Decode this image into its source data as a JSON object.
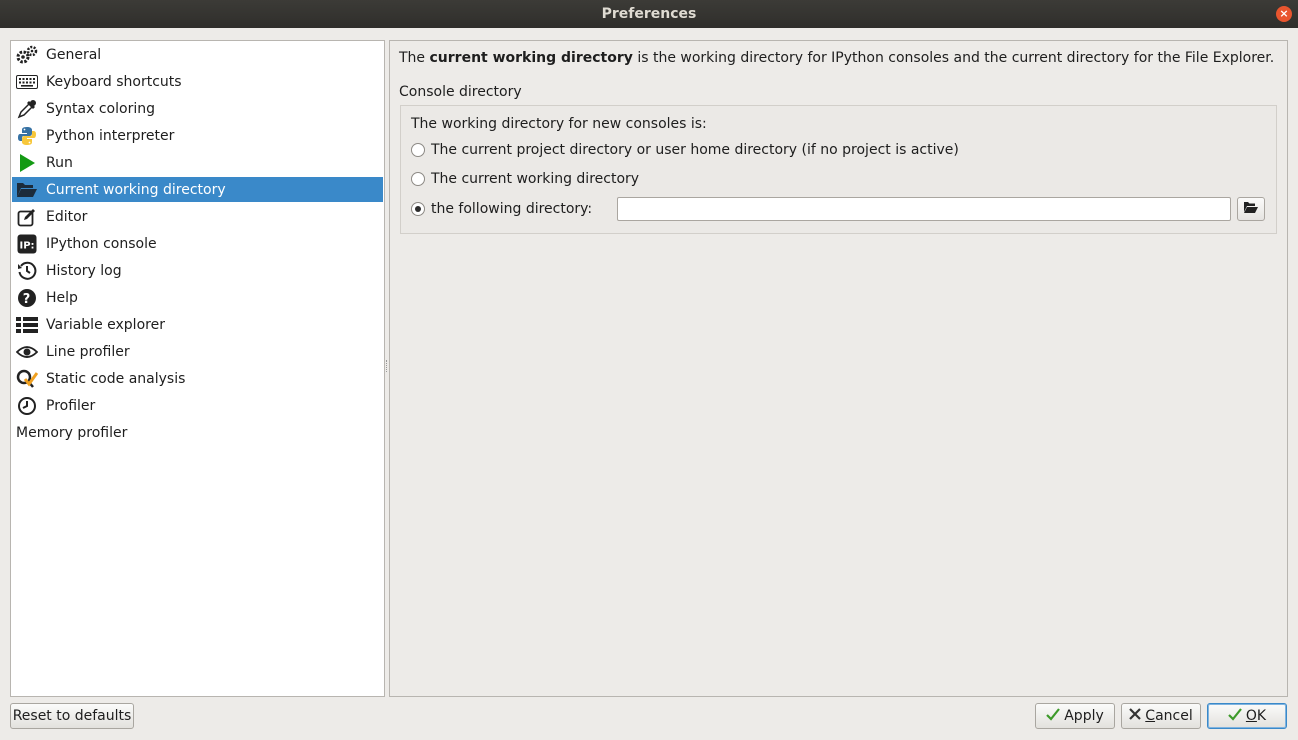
{
  "window": {
    "title": "Preferences",
    "close_glyph": "×"
  },
  "sidebar": {
    "items": [
      {
        "label": "General",
        "icon": "gears-icon"
      },
      {
        "label": "Keyboard shortcuts",
        "icon": "keyboard-icon"
      },
      {
        "label": "Syntax coloring",
        "icon": "eyedropper-icon"
      },
      {
        "label": "Python interpreter",
        "icon": "python-logo-icon"
      },
      {
        "label": "Run",
        "icon": "play-icon"
      },
      {
        "label": "Current working directory",
        "icon": "folder-open-icon",
        "selected": true
      },
      {
        "label": "Editor",
        "icon": "edit-icon"
      },
      {
        "label": "IPython console",
        "icon": "ipython-icon"
      },
      {
        "label": "History log",
        "icon": "history-icon"
      },
      {
        "label": "Help",
        "icon": "question-icon"
      },
      {
        "label": "Variable explorer",
        "icon": "list-table-icon"
      },
      {
        "label": "Line profiler",
        "icon": "eye-icon"
      },
      {
        "label": "Static code analysis",
        "icon": "code-analysis-icon"
      },
      {
        "label": "Profiler",
        "icon": "clock-icon"
      },
      {
        "label": "Memory profiler",
        "icon": ""
      }
    ]
  },
  "content": {
    "intro_prefix": "The ",
    "intro_bold": "current working directory",
    "intro_suffix": " is the working directory for IPython consoles and the current directory for the File Explorer.",
    "group_title": "Console directory",
    "group_label": "The working directory for new consoles is:",
    "options": [
      {
        "label": "The current project directory or user home directory (if no project is active)",
        "checked": false
      },
      {
        "label": "The current working directory",
        "checked": false
      },
      {
        "label": "the following directory:",
        "checked": true
      }
    ],
    "directory_value": ""
  },
  "footer": {
    "reset_label": "Reset to defaults",
    "apply_label": "Apply",
    "cancel_first": "C",
    "cancel_rest": "ancel",
    "ok_first": "O",
    "ok_rest": "K"
  },
  "colors": {
    "selection": "#3a89c9",
    "titlebar": "#3c3b37",
    "close": "#e9552e"
  }
}
